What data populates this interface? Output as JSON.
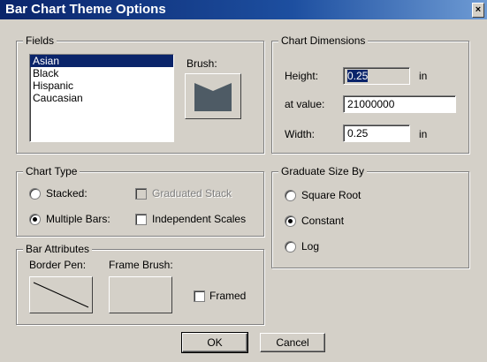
{
  "window": {
    "title": "Bar Chart Theme Options",
    "close_label": "×"
  },
  "fields": {
    "legend": "Fields",
    "items": [
      "Asian",
      "Black",
      "Hispanic",
      "Caucasian"
    ],
    "selected_index": 0,
    "brush_label": "Brush:"
  },
  "chart_dimensions": {
    "legend": "Chart Dimensions",
    "height_label": "Height:",
    "height_value": "0.25",
    "height_unit": "in",
    "at_value_label": "at value:",
    "at_value": "21000000",
    "width_label": "Width:",
    "width_value": "0.25",
    "width_unit": "in"
  },
  "chart_type": {
    "legend": "Chart Type",
    "stacked_label": "Stacked:",
    "stacked_selected": false,
    "multiple_bars_label": "Multiple Bars:",
    "multiple_bars_selected": true,
    "graduated_stack_label": "Graduated Stack",
    "graduated_stack_enabled": false,
    "independent_scales_label": "Independent Scales",
    "independent_scales_checked": false
  },
  "graduate_size_by": {
    "legend": "Graduate Size By",
    "options": [
      "Square Root",
      "Constant",
      "Log"
    ],
    "selected": "Constant"
  },
  "bar_attributes": {
    "legend": "Bar Attributes",
    "border_pen_label": "Border Pen:",
    "frame_brush_label": "Frame Brush:",
    "framed_label": "Framed",
    "framed_checked": false
  },
  "buttons": {
    "ok": "OK",
    "cancel": "Cancel"
  },
  "colors": {
    "title_bar": "#0a246a",
    "brush_fill": "#4e5b65",
    "selection": "#0a246a"
  }
}
